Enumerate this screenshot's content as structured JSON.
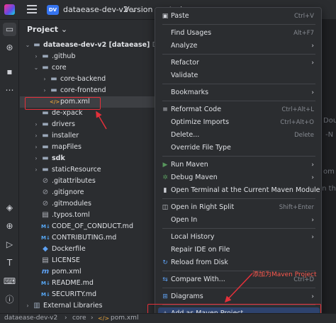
{
  "titlebar": {
    "badge": "DV",
    "project_name": "dataease-dev-v2",
    "version_control": "Version control"
  },
  "panel": {
    "title": "Project"
  },
  "tree": [
    {
      "label": "dataease-dev-v2",
      "suffix": "[dataease]",
      "path": "D:\\test\\",
      "icon": "folder",
      "indent": 0,
      "chevron": "open",
      "bold": true
    },
    {
      "label": ".github",
      "icon": "folder",
      "indent": 1,
      "chevron": "closed"
    },
    {
      "label": "core",
      "icon": "folder",
      "indent": 1,
      "chevron": "open"
    },
    {
      "label": "core-backend",
      "icon": "folder",
      "indent": 2,
      "chevron": "closed"
    },
    {
      "label": "core-frontend",
      "icon": "folder",
      "indent": 2,
      "chevron": "closed"
    },
    {
      "label": "pom.xml",
      "icon": "xml",
      "indent": 2,
      "chevron": "",
      "selected": true
    },
    {
      "label": "de-xpack",
      "icon": "folder",
      "indent": 1,
      "chevron": ""
    },
    {
      "label": "drivers",
      "icon": "folder",
      "indent": 1,
      "chevron": "closed"
    },
    {
      "label": "installer",
      "icon": "folder",
      "indent": 1,
      "chevron": "closed"
    },
    {
      "label": "mapFiles",
      "icon": "folder",
      "indent": 1,
      "chevron": "closed"
    },
    {
      "label": "sdk",
      "icon": "folder",
      "indent": 1,
      "chevron": "closed",
      "bold": true
    },
    {
      "label": "staticResource",
      "icon": "folder",
      "indent": 1,
      "chevron": "closed"
    },
    {
      "label": ".gitattributes",
      "icon": "git",
      "indent": 1,
      "chevron": ""
    },
    {
      "label": ".gitignore",
      "icon": "git",
      "indent": 1,
      "chevron": ""
    },
    {
      "label": ".gitmodules",
      "icon": "git",
      "indent": 1,
      "chevron": ""
    },
    {
      "label": ".typos.toml",
      "icon": "file",
      "indent": 1,
      "chevron": ""
    },
    {
      "label": "CODE_OF_CONDUCT.md",
      "icon": "md",
      "indent": 1,
      "chevron": ""
    },
    {
      "label": "CONTRIBUTING.md",
      "icon": "md",
      "indent": 1,
      "chevron": ""
    },
    {
      "label": "Dockerfile",
      "icon": "docker",
      "indent": 1,
      "chevron": ""
    },
    {
      "label": "LICENSE",
      "icon": "file",
      "indent": 1,
      "chevron": ""
    },
    {
      "label": "pom.xml",
      "icon": "maven",
      "indent": 1,
      "chevron": ""
    },
    {
      "label": "README.md",
      "icon": "md",
      "indent": 1,
      "chevron": ""
    },
    {
      "label": "SECURITY.md",
      "icon": "md",
      "indent": 1,
      "chevron": ""
    },
    {
      "label": "External Libraries",
      "icon": "lib",
      "indent": 0,
      "chevron": "closed"
    }
  ],
  "editor": {
    "hint1": "Doul",
    "hint2": "-N",
    "hint3": "om",
    "hint4": "en the"
  },
  "context_menu": {
    "items": [
      {
        "label": "Paste",
        "shortcut": "Ctrl+V",
        "icon": "paste"
      },
      {
        "label": "Find Usages",
        "underline": "U",
        "shortcut": "Alt+F7"
      },
      {
        "label": "Analyze",
        "submenu": true
      },
      {
        "label": "Refactor",
        "submenu": true
      },
      {
        "label": "Validate"
      },
      {
        "label": "Bookmarks",
        "submenu": true
      },
      {
        "label": "Reformat Code",
        "shortcut": "Ctrl+Alt+L",
        "icon": "reformat"
      },
      {
        "label": "Optimize Imports",
        "shortcut": "Ctrl+Alt+O"
      },
      {
        "label": "Delete...",
        "shortcut": "Delete"
      },
      {
        "label": "Override File Type"
      },
      {
        "label": "Run Maven",
        "submenu": true,
        "icon": "run"
      },
      {
        "label": "Debug Maven",
        "submenu": true,
        "icon": "debug"
      },
      {
        "label": "Open Terminal at the Current Maven Module Path",
        "icon": "terminal"
      },
      {
        "label": "Open in Right Split",
        "shortcut": "Shift+Enter",
        "icon": "split"
      },
      {
        "label": "Open In",
        "submenu": true
      },
      {
        "label": "Local History",
        "submenu": true
      },
      {
        "label": "Repair IDE on File"
      },
      {
        "label": "Reload from Disk",
        "icon": "reload"
      },
      {
        "label": "Compare With...",
        "shortcut": "Ctrl+D",
        "icon": "compare"
      },
      {
        "label": "Diagrams",
        "submenu": true,
        "icon": "diagram"
      },
      {
        "label": "Add as Maven Project",
        "icon": "plus",
        "highlighted": true
      }
    ],
    "annotation": "添加为Maven Project"
  },
  "statusbar": {
    "crumb1": "dataease-dev-v2",
    "crumb2": "core",
    "crumb3": "pom.xml"
  },
  "colors": {
    "accent": "#3574f0",
    "annotation_red": "#e5303a",
    "highlight": "#2e436e"
  }
}
